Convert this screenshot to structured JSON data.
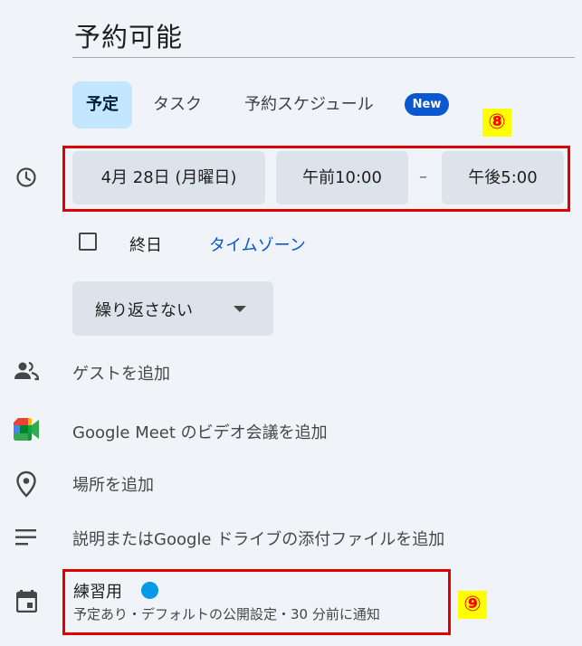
{
  "title": "予約可能",
  "tabs": [
    {
      "label": "予定"
    },
    {
      "label": "タスク"
    },
    {
      "label": "予約スケジュール"
    }
  ],
  "new_badge": "New",
  "markers": {
    "time": "⑧",
    "calendar": "⑨"
  },
  "datetime": {
    "date": "4月 28日 (月曜日)",
    "start": "午前10:00",
    "separator": "–",
    "end": "午後5:00"
  },
  "allday": {
    "label": "終日",
    "timezone_link": "タイムゾーン"
  },
  "recurrence": {
    "selected": "繰り返さない"
  },
  "rows": {
    "guests": "ゲストを追加",
    "meet": "Google Meet のビデオ会議を追加",
    "location": "場所を追加",
    "description": "説明またはGoogle ドライブの添付ファイルを追加"
  },
  "calendar": {
    "name": "練習用",
    "detail": "予定あり・デフォルトの公開設定・30 分前に通知",
    "color": "#039be5"
  },
  "colors": {
    "accent": "#0b57d0",
    "active_tab": "#c2e7ff",
    "chip": "#dde3ea",
    "highlight_border": "#e00000",
    "marker_bg": "#ffff00",
    "marker_text": "#ff0000"
  },
  "icons": {
    "time": "clock-icon",
    "guests": "people-icon",
    "meet": "google-meet-icon",
    "location": "location-pin-icon",
    "description": "notes-icon",
    "calendar": "calendar-icon"
  }
}
